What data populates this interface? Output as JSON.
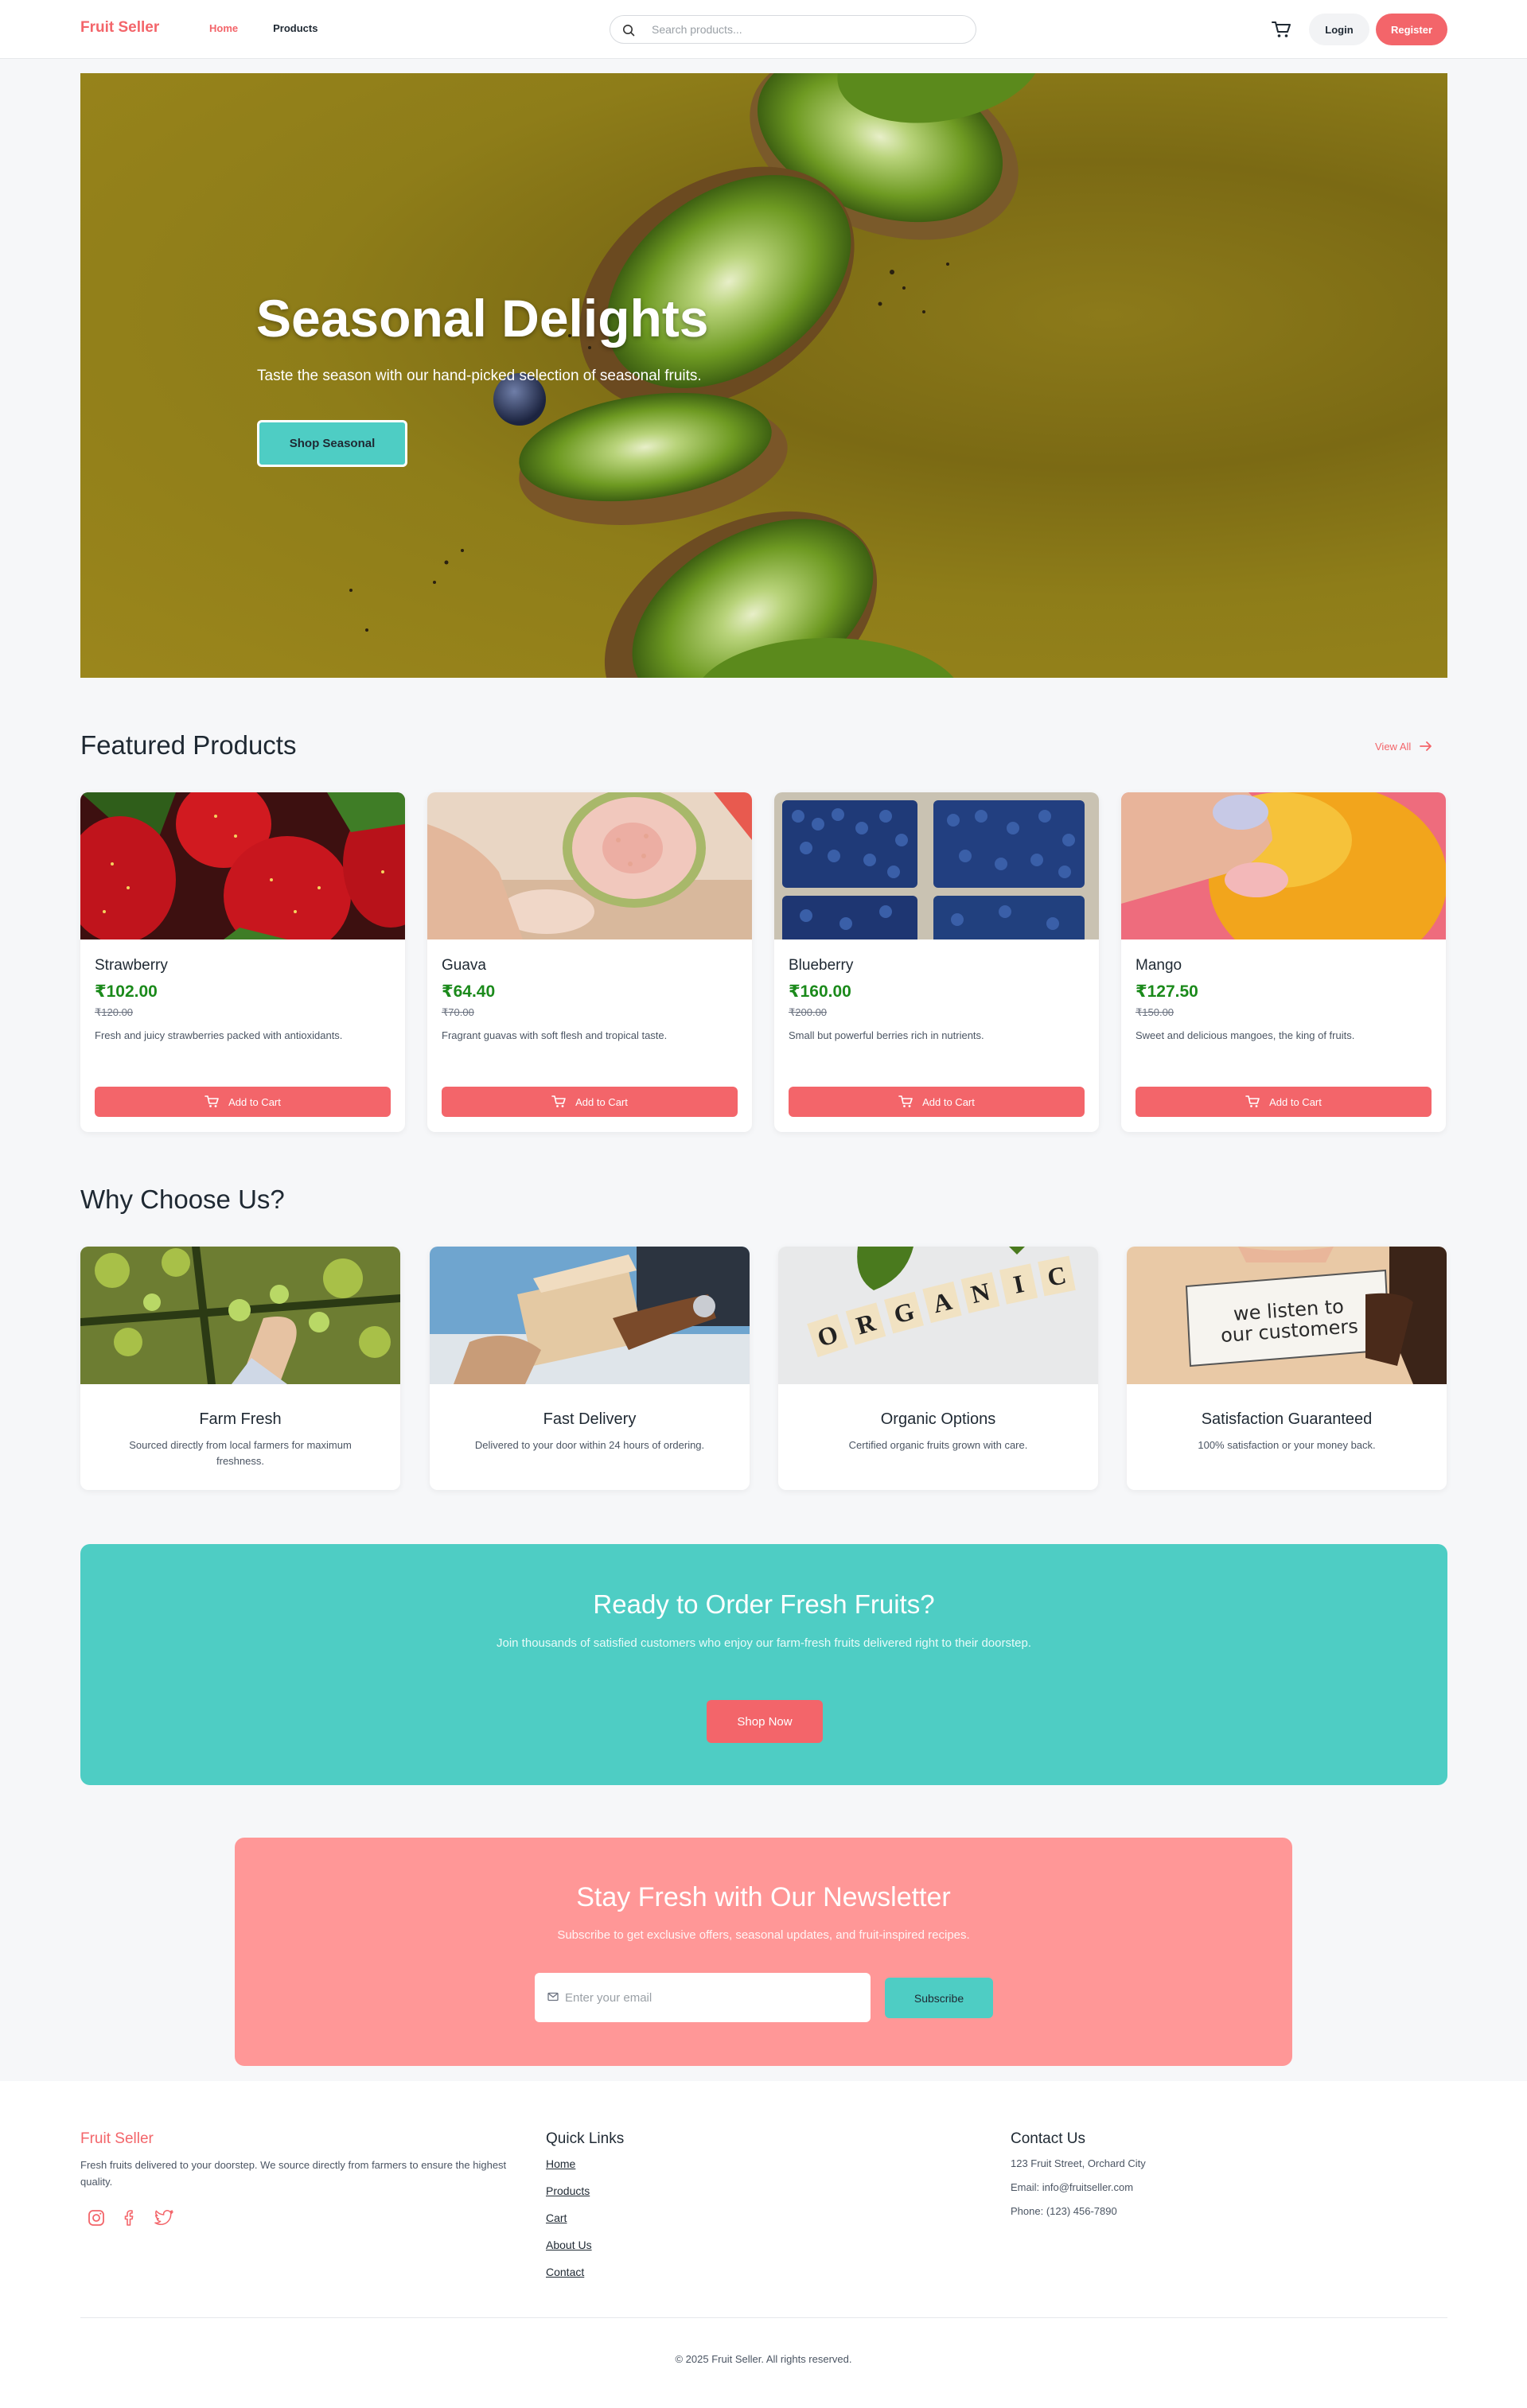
{
  "header": {
    "logo": "Fruit Seller",
    "nav": [
      {
        "label": "Home",
        "active": true
      },
      {
        "label": "Products",
        "active": false
      }
    ],
    "search": {
      "placeholder": "Search products...",
      "icon": "search-icon"
    },
    "cart_icon": "cart-icon",
    "login_label": "Login",
    "register_label": "Register"
  },
  "hero": {
    "title": "Seasonal Delights",
    "subtitle": "Taste the season with our hand-picked selection of seasonal fruits.",
    "button_label": "Shop Seasonal"
  },
  "featured": {
    "title": "Featured Products",
    "view_all": "View All",
    "add_to_cart_label": "Add to Cart",
    "products": [
      {
        "name": "Strawberry",
        "price": "₹102.00",
        "old_price": "₹120.00",
        "description": "Fresh and juicy strawberries packed with antioxidants."
      },
      {
        "name": "Guava",
        "price": "₹64.40",
        "old_price": "₹70.00",
        "description": "Fragrant guavas with soft flesh and tropical taste."
      },
      {
        "name": "Blueberry",
        "price": "₹160.00",
        "old_price": "₹200.00",
        "description": "Small but powerful berries rich in nutrients."
      },
      {
        "name": "Mango",
        "price": "₹127.50",
        "old_price": "₹150.00",
        "description": "Sweet and delicious mangoes, the king of fruits."
      }
    ]
  },
  "why": {
    "title": "Why Choose Us?",
    "items": [
      {
        "title": "Farm Fresh",
        "description": "Sourced directly from local farmers for maximum freshness."
      },
      {
        "title": "Fast Delivery",
        "description": "Delivered to your door within 24 hours of ordering."
      },
      {
        "title": "Organic Options",
        "description": "Certified organic fruits grown with care.",
        "image_text": [
          "O",
          "R",
          "G",
          "A",
          "N",
          "I",
          "C"
        ]
      },
      {
        "title": "Satisfaction Guaranteed",
        "description": "100% satisfaction or your money back.",
        "image_text": [
          "we listen to",
          "our customers"
        ]
      }
    ]
  },
  "cta": {
    "title": "Ready to Order Fresh Fruits?",
    "subtitle": "Join thousands of satisfied customers who enjoy our farm-fresh fruits delivered right to their doorstep.",
    "button_label": "Shop Now"
  },
  "newsletter": {
    "title": "Stay Fresh with Our Newsletter",
    "subtitle": "Subscribe to get exclusive offers, seasonal updates, and fruit-inspired recipes.",
    "email_placeholder": "Enter your email",
    "button_label": "Subscribe"
  },
  "footer": {
    "brand": "Fruit Seller",
    "brand_description": "Fresh fruits delivered to your doorstep. We source directly from farmers to ensure the highest quality.",
    "socials": [
      "instagram-icon",
      "facebook-icon",
      "twitter-icon"
    ],
    "quick_links_title": "Quick Links",
    "quick_links": [
      "Home",
      "Products",
      "Cart",
      "About Us",
      "Contact"
    ],
    "contact_title": "Contact Us",
    "contact": [
      "123 Fruit Street, Orchard City",
      "Email: info@fruitseller.com",
      "Phone: (123) 456-7890"
    ],
    "copyright": "© 2025 Fruit Seller. All rights reserved."
  },
  "colors": {
    "accent": "#f3656a",
    "teal": "#4ecdc4",
    "newsletter_bg": "#ff9797",
    "price_green": "#1b8a1b"
  }
}
